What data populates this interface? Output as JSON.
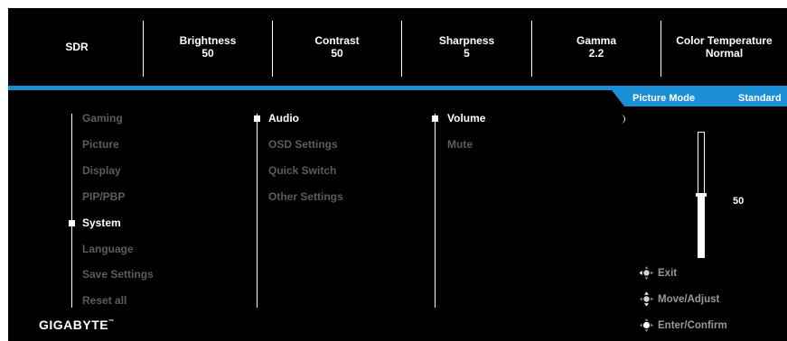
{
  "header": {
    "items": [
      {
        "label": "SDR",
        "value": ""
      },
      {
        "label": "Brightness",
        "value": "50"
      },
      {
        "label": "Contrast",
        "value": "50"
      },
      {
        "label": "Sharpness",
        "value": "5"
      },
      {
        "label": "Gamma",
        "value": "2.2"
      },
      {
        "label": "Color Temperature",
        "value": "Normal"
      }
    ]
  },
  "status": {
    "mode_label": "Picture Mode",
    "mode_value": "Standard"
  },
  "menu": {
    "main": [
      "Gaming",
      "Picture",
      "Display",
      "PIP/PBP",
      "System",
      "Language",
      "Save Settings",
      "Reset all"
    ],
    "main_selected": "System",
    "sub": [
      "Audio",
      "OSD Settings",
      "Quick Switch",
      "Other Settings"
    ],
    "sub_selected": "Audio",
    "sub2": [
      "Volume",
      "Mute"
    ],
    "sub2_selected": "Volume"
  },
  "slider": {
    "value": "50",
    "level": 0.5
  },
  "hints": [
    {
      "icon": "joystick-left-icon",
      "label": "Exit"
    },
    {
      "icon": "joystick-updown-icon",
      "label": "Move/Adjust"
    },
    {
      "icon": "joystick-press-icon",
      "label": "Enter/Confirm"
    }
  ],
  "brand": {
    "name": "GIGABYTE",
    "tm": "™"
  },
  "colors": {
    "accent": "#1b8fd6",
    "background": "#000000",
    "inactive_text": "#5c5c5c",
    "active_text": "#ffffff"
  }
}
